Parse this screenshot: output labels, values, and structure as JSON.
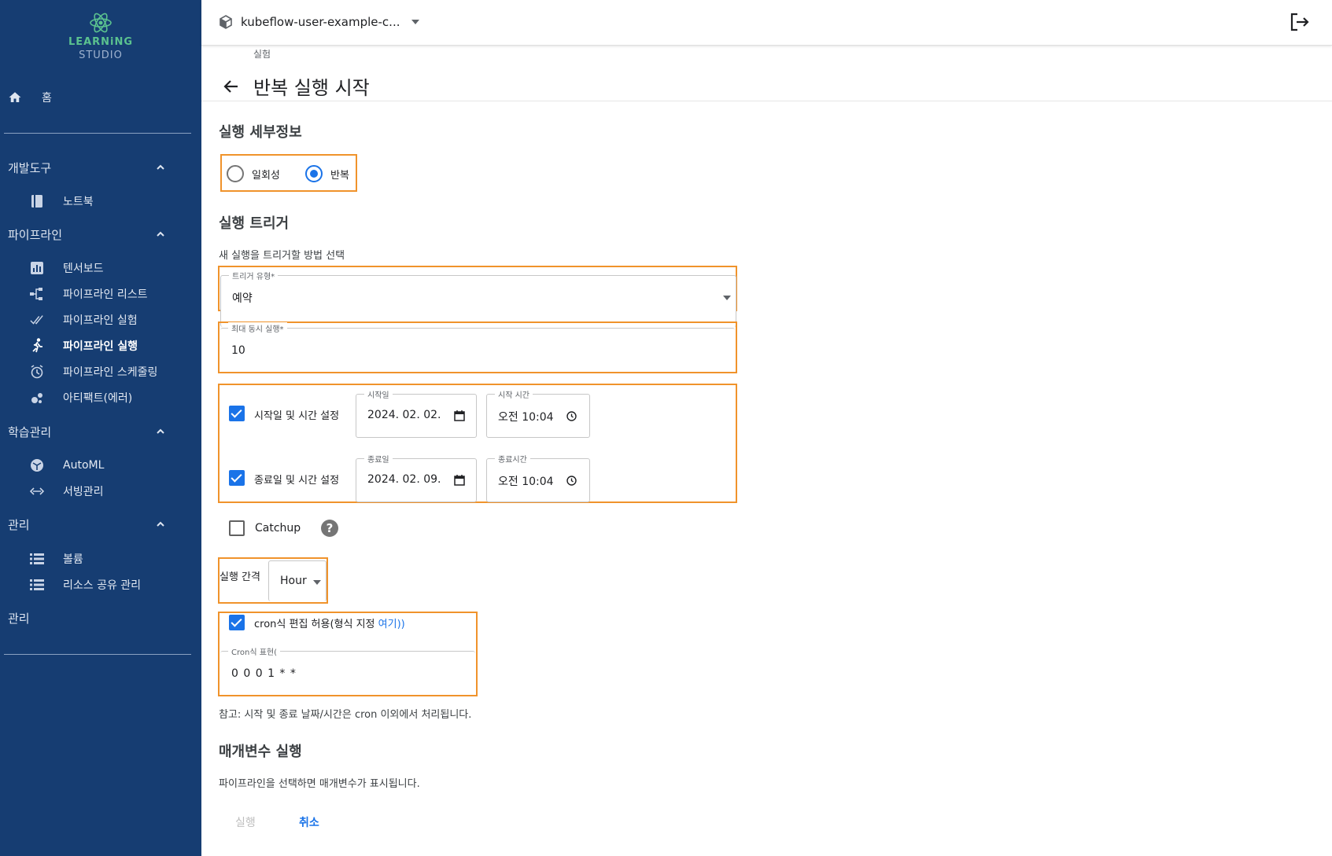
{
  "app": {
    "logo_line1": "LEARNiNG",
    "logo_line2": "STUDIO"
  },
  "topbar": {
    "namespace": "kubeflow-user-example-c..."
  },
  "sidebar": {
    "home": "홈",
    "sections": [
      {
        "label": "개발도구",
        "items": [
          {
            "label": "노트북",
            "icon": "notebook-icon"
          }
        ]
      },
      {
        "label": "파이프라인",
        "items": [
          {
            "label": "텐서보드",
            "icon": "bar-chart-icon"
          },
          {
            "label": "파이프라인 리스트",
            "icon": "pipeline-list-icon"
          },
          {
            "label": "파이프라인 실험",
            "icon": "done-all-icon"
          },
          {
            "label": "파이프라인 실행",
            "icon": "run-icon",
            "active": true
          },
          {
            "label": "파이프라인 스케줄링",
            "icon": "alarm-icon"
          },
          {
            "label": "아티팩트(에러)",
            "icon": "bubble-icon"
          }
        ]
      },
      {
        "label": "학습관리",
        "items": [
          {
            "label": "AutoML",
            "icon": "automl-icon"
          },
          {
            "label": "서빙관리",
            "icon": "code-arrows-icon"
          }
        ]
      },
      {
        "label": "관리",
        "items": [
          {
            "label": "볼륨",
            "icon": "list-icon"
          },
          {
            "label": "리소스 공유 관리",
            "icon": "list-icon"
          }
        ]
      }
    ],
    "bottom_section": "관리"
  },
  "page": {
    "breadcrumb": "실험",
    "title": "반복 실행 시작",
    "run_details_heading": "실행 세부정보",
    "run_type": {
      "options": [
        "일회성",
        "반복"
      ],
      "selected": "반복"
    },
    "trigger_heading": "실행 트리거",
    "trigger_desc": "새 실행을 트리거할 방법 선택",
    "trigger_type": {
      "label": "트리거 유형*",
      "value": "예약"
    },
    "max_concurrent": {
      "label": "최대 동시 실행*",
      "value": "10"
    },
    "start": {
      "checkbox_label": "시작일 및 시간 설정",
      "checked": true,
      "date_label": "시작일",
      "date_value": "2024. 02. 02.",
      "time_label": "시작 시간",
      "time_value": "오전 10:04"
    },
    "end": {
      "checkbox_label": "종료일 및 시간 설정",
      "checked": true,
      "date_label": "종료일",
      "date_value": "2024. 02. 09.",
      "time_label": "종료시간",
      "time_value": "오전 10:04"
    },
    "catchup": {
      "label": "Catchup",
      "checked": false,
      "help": "?"
    },
    "interval": {
      "label": "실행 간격",
      "value": "Hour"
    },
    "cron": {
      "checkbox_label": "cron식 편집 허용(형식 지정 ",
      "link": "여기",
      "suffix": "))",
      "checked": true,
      "field_label": "Cron식 표현(",
      "value": "0 0 0 1 * *"
    },
    "note": "참고: 시작 및 종료 날짜/시간은 cron 이외에서 처리됩니다.",
    "params_heading": "매개변수 실행",
    "params_desc": "파이프라인을 선택하면 매개변수가 표시됩니다.",
    "run_button": "실행",
    "cancel_button": "취소"
  },
  "colors": {
    "sidebar_bg": "#163d72",
    "accent": "#1a73e8",
    "highlight": "#f0932b"
  }
}
